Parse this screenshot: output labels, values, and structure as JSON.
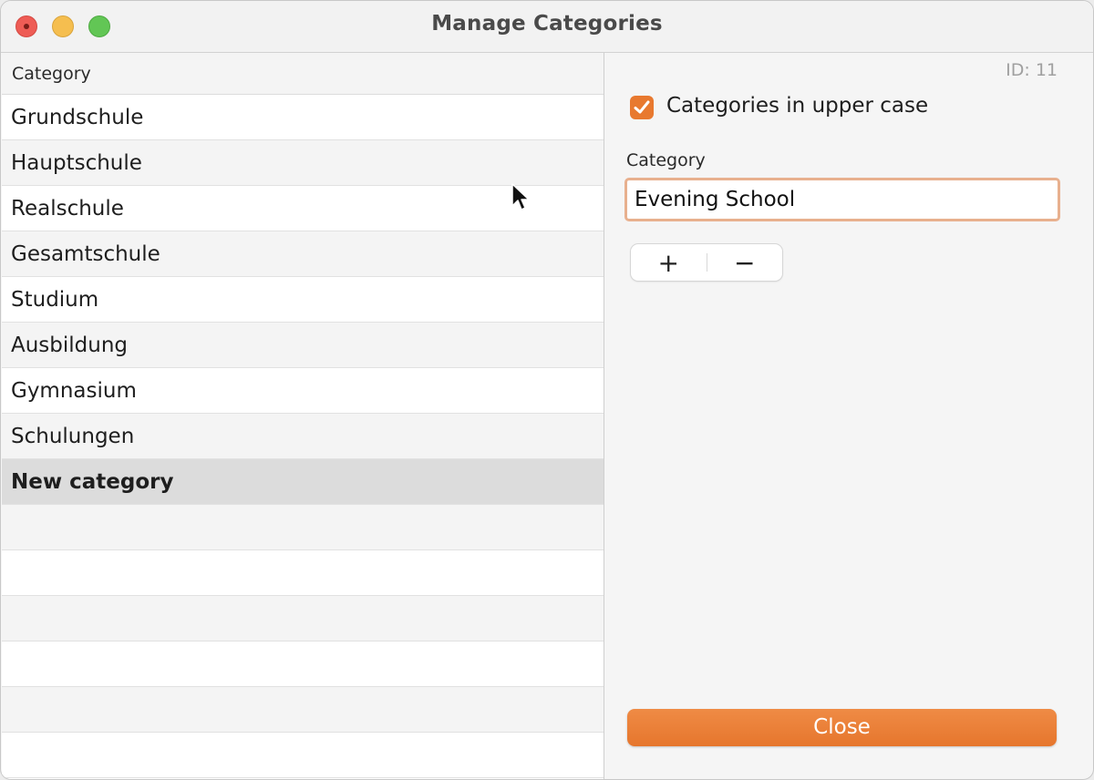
{
  "window": {
    "title": "Manage Categories"
  },
  "list": {
    "header": "Category",
    "rows": [
      "Grundschule",
      "Hauptschule",
      "Realschule",
      "Gesamtschule",
      "Studium",
      "Ausbildung",
      "Gymnasium",
      "Schulungen",
      "New category"
    ],
    "selected_index": 8
  },
  "detail": {
    "id_text": "ID: 11",
    "uppercase_label": "Categories in upper case",
    "uppercase_checked": true,
    "category_label": "Category",
    "category_value": "Evening School",
    "add_label": "+",
    "remove_label": "−",
    "close_label": "Close"
  },
  "colors": {
    "accent": "#e8792f",
    "selected_row": "#dcdcdc"
  }
}
